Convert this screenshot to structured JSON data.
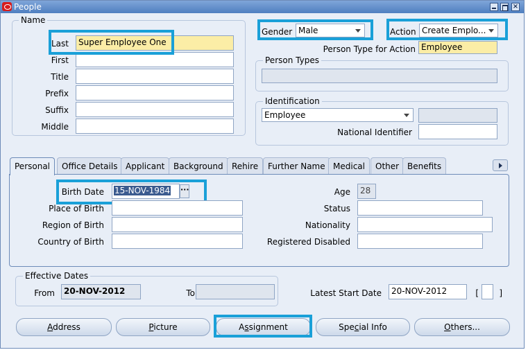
{
  "window": {
    "title": "People"
  },
  "name_group": {
    "label": "Name",
    "last_label": "Last",
    "last_value": "Super Employee One",
    "first_label": "First",
    "first_value": "",
    "title_label": "Title",
    "title_value": "",
    "prefix_label": "Prefix",
    "prefix_value": "",
    "suffix_label": "Suffix",
    "suffix_value": "",
    "middle_label": "Middle",
    "middle_value": ""
  },
  "gender": {
    "label": "Gender",
    "value": "Male"
  },
  "action": {
    "label": "Action",
    "value": "Create Emplo..."
  },
  "person_type_action": {
    "label": "Person Type for Action",
    "value": "Employee"
  },
  "person_types": {
    "label": "Person Types",
    "value": ""
  },
  "identification": {
    "label": "Identification",
    "type_value": "Employee",
    "number_value": "",
    "national_id_label": "National Identifier",
    "national_id_value": ""
  },
  "tabs": [
    {
      "label": "Personal"
    },
    {
      "label": "Office Details"
    },
    {
      "label": "Applicant"
    },
    {
      "label": "Background"
    },
    {
      "label": "Rehire"
    },
    {
      "label": "Further Name"
    },
    {
      "label": "Medical"
    },
    {
      "label": "Other"
    },
    {
      "label": "Benefits"
    }
  ],
  "personal": {
    "birth_date_label": "Birth Date",
    "birth_date_value": "15-NOV-1984",
    "place_of_birth_label": "Place of Birth",
    "place_of_birth_value": "",
    "region_of_birth_label": "Region of Birth",
    "region_of_birth_value": "",
    "country_of_birth_label": "Country of Birth",
    "country_of_birth_value": "",
    "age_label": "Age",
    "age_value": "28",
    "status_label": "Status",
    "status_value": "",
    "nationality_label": "Nationality",
    "nationality_value": "",
    "registered_disabled_label": "Registered Disabled",
    "registered_disabled_value": ""
  },
  "effective_dates": {
    "label": "Effective Dates",
    "from_label": "From",
    "from_value": "20-NOV-2012",
    "to_label": "To",
    "to_value": ""
  },
  "latest_start": {
    "label": "Latest Start Date",
    "value": "20-NOV-2012",
    "bracket_open": "[",
    "bracket_close": "]"
  },
  "buttons": {
    "address_pre": "",
    "address_u": "A",
    "address_post": "ddress",
    "picture_pre": "",
    "picture_u": "P",
    "picture_post": "icture",
    "assignment_pre": "A",
    "assignment_u": "s",
    "assignment_post": "signment",
    "special_pre": "Spe",
    "special_u": "c",
    "special_post": "ial Info",
    "others_pre": "",
    "others_u": "O",
    "others_post": "thers..."
  },
  "icons": {
    "app": "oracle-icon",
    "minimize": "minimize-icon",
    "maximize": "maximize-icon",
    "close": "close-icon",
    "scroll_tabs": "tab-scroll-right-icon",
    "lov": "ellipsis-icon"
  },
  "colors": {
    "highlight": "#1aa0d8",
    "required": "#fbeda6",
    "background": "#e8eef7"
  }
}
